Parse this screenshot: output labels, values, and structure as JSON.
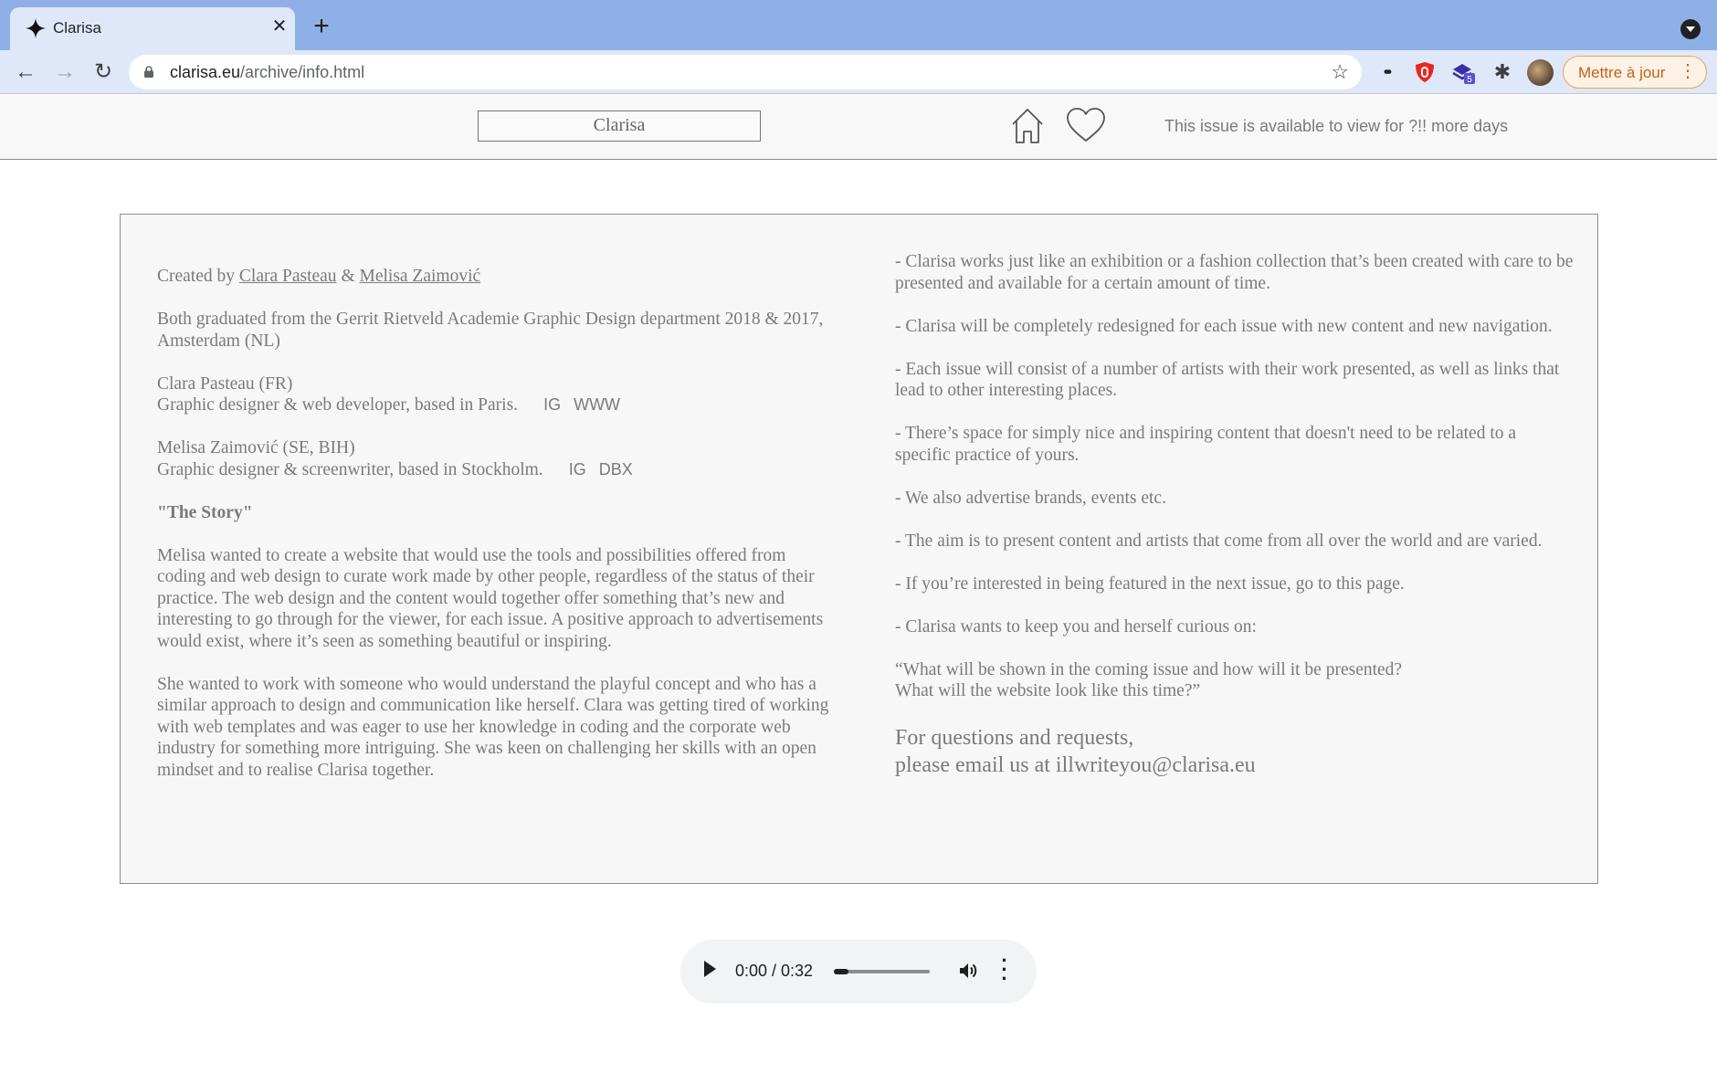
{
  "browser": {
    "tab": {
      "title": "Clarisa",
      "close_glyph": "✕",
      "favicon": "sparkle-icon"
    },
    "new_tab_glyph": "+",
    "nav": {
      "back": "←",
      "forward": "→",
      "reload": "↻"
    },
    "url": {
      "host": "clarisa.eu",
      "path": "/archive/info.html"
    },
    "bookmark_glyph": "☆",
    "extensions": {
      "eye_glyph": "••",
      "ublock": "ublock-icon",
      "badge": "5",
      "puzzle_glyph": "✱"
    },
    "update_button": {
      "label": "Mettre à jour",
      "dots": "⋮"
    },
    "colors": {
      "tabstrip": "#8fb0e6",
      "toolbar": "#dfe8f8",
      "update_accent": "#c2631b"
    }
  },
  "site_header": {
    "logo": "Clarisa",
    "availability": "This issue is available to view for ?!! more days"
  },
  "info": {
    "created_prefix": "Created by ",
    "author1": "Clara Pasteau",
    "ampersand": " & ",
    "author2": "Melisa Zaimović",
    "graduated": "Both graduated from the Gerrit Rietveld Academie Graphic Design department 2018 & 2017, Amsterdam (NL)",
    "clara": {
      "name": "Clara Pasteau (FR)",
      "role": "Graphic designer & web developer, based in Paris.",
      "link1": "IG",
      "link2": "WWW"
    },
    "melisa": {
      "name": "Melisa Zaimović (SE, BIH)",
      "role": "Graphic designer & screenwriter, based in Stockholm.",
      "link1": "IG",
      "link2": "DBX"
    },
    "story_title": "\"The Story\"",
    "story_p1": "Melisa wanted to create a website that would use the tools and possibilities offered from coding and web design to curate work made by other people, regardless of the status of their practice. The web design and the content would together offer something that’s new and interesting to go through for the viewer, for each issue. A positive approach to advertisements would exist, where it’s seen as something beautiful or inspiring.",
    "story_p2": "She wanted to work with someone who would understand the playful concept and who has a similar approach to design and communication like herself. Clara was getting tired of working with web templates and was eager to use her knowledge in coding and the corporate web industry for something more intriguing. She was keen on challenging her skills with an open mindset and to realise Clarisa together.",
    "points": [
      "- Clarisa works just like an exhibition or a fashion collection that’s been created with care to be presented and available for a certain amount of time.",
      "- Clarisa will be completely redesigned for each issue with new content and new navigation.",
      "- Each issue will consist of a number of artists with their work presented, as well as links that lead to other interesting places.",
      "- There’s space for simply nice and inspiring content that doesn't need to be related to a specific practice of yours.",
      "- We also advertise brands, events etc.",
      "- The aim is to present content and artists that come from all over the world and are varied.",
      "- If you’re interested in being featured in the next issue, go to this page.",
      "- Clarisa wants to keep you and herself curious on:"
    ],
    "quote_line1": "“What will be shown in the coming issue and how will it be presented?",
    "quote_line2": "What will the website look like this time?”",
    "contact_line1": "For questions and requests,",
    "contact_line2": "please email us at illwriteyou@clarisa.eu"
  },
  "audio": {
    "time": "0:00 / 0:32",
    "progress": 0.0
  }
}
